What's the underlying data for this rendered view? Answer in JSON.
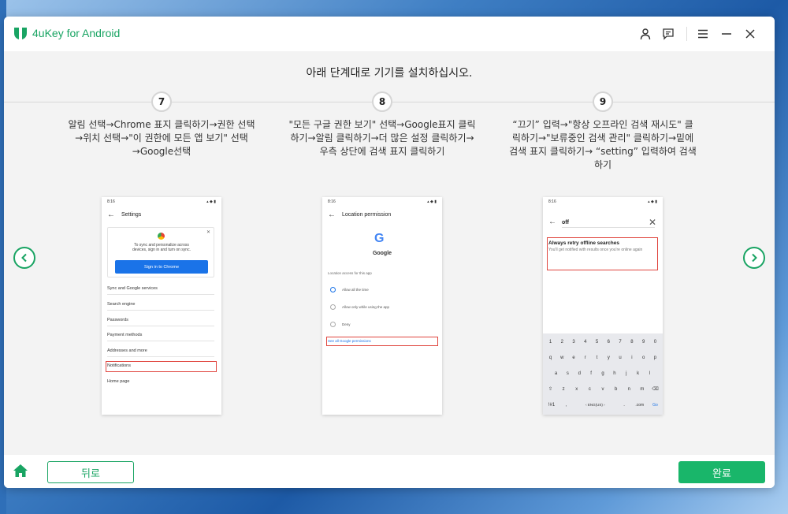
{
  "app": {
    "title": "4uKey for Android",
    "accent": "#19a463"
  },
  "titlebar": {
    "icons": [
      "user-icon",
      "feedback-icon",
      "menu-icon",
      "minimize-icon",
      "close-icon"
    ]
  },
  "heading": "아래 단계대로 기기를 설치하십시오.",
  "steps": [
    {
      "number": "7",
      "lines": [
        "알림 선택→Chrome 표지 클릭하기→권한 선택",
        "→위치 선택→\"이 권한에 모든 앱 보기\" 선택",
        "→Google선택"
      ],
      "phone": {
        "time": "8:16",
        "title": "Settings",
        "card_text": [
          "To sync and personalize across",
          "devices, sign in and turn on sync."
        ],
        "sign_in": "Sign in to Chrome",
        "items": [
          "Sync and Google services",
          "Search engine",
          "Passwords",
          "Payment methods",
          "Addresses and more",
          "Notifications",
          "Home page"
        ]
      }
    },
    {
      "number": "8",
      "lines": [
        "\"모든 구글 권한 보기\" 선택→Google표지 클릭",
        "하기→알림 클릭하기→더 많은 설정 클릭하기→",
        "우측 상단에 검색 표지 클릭하기"
      ],
      "phone": {
        "time": "8:16",
        "title": "Location permission",
        "logo_letter": "G",
        "brand": "Google",
        "caption": "Location access for this app",
        "options": [
          "Allow all the time",
          "Allow only while using the app",
          "Deny"
        ],
        "link": "See all Google permissions"
      }
    },
    {
      "number": "9",
      "lines": [
        "“끄기” 입력→\"항상 오프라인 검색 재시도\" 클",
        "릭하기→\"보류중인 검색 관리\" 클릭하기→밑에",
        "검색 표지 클릭하기→ “setting” 입력하여 검색",
        "하기"
      ],
      "phone": {
        "time": "8:16",
        "query": "off",
        "result_title": "Always retry offline searches",
        "result_sub": "You'll get notified with results once you're online again",
        "keyboard": [
          [
            "1",
            "2",
            "3",
            "4",
            "5",
            "6",
            "7",
            "8",
            "9",
            "0"
          ],
          [
            "q",
            "w",
            "e",
            "r",
            "t",
            "y",
            "u",
            "i",
            "o",
            "p"
          ],
          [
            "a",
            "s",
            "d",
            "f",
            "g",
            "h",
            "j",
            "k",
            "l"
          ],
          [
            "⇧",
            "z",
            "x",
            "c",
            "v",
            "b",
            "n",
            "m",
            "⌫"
          ],
          [
            "!#1",
            ",",
            "‹  ENG(US)  ›",
            ".",
            ".com",
            "Go"
          ]
        ]
      }
    }
  ],
  "footer": {
    "back_label": "뒤로",
    "done_label": "완료"
  }
}
